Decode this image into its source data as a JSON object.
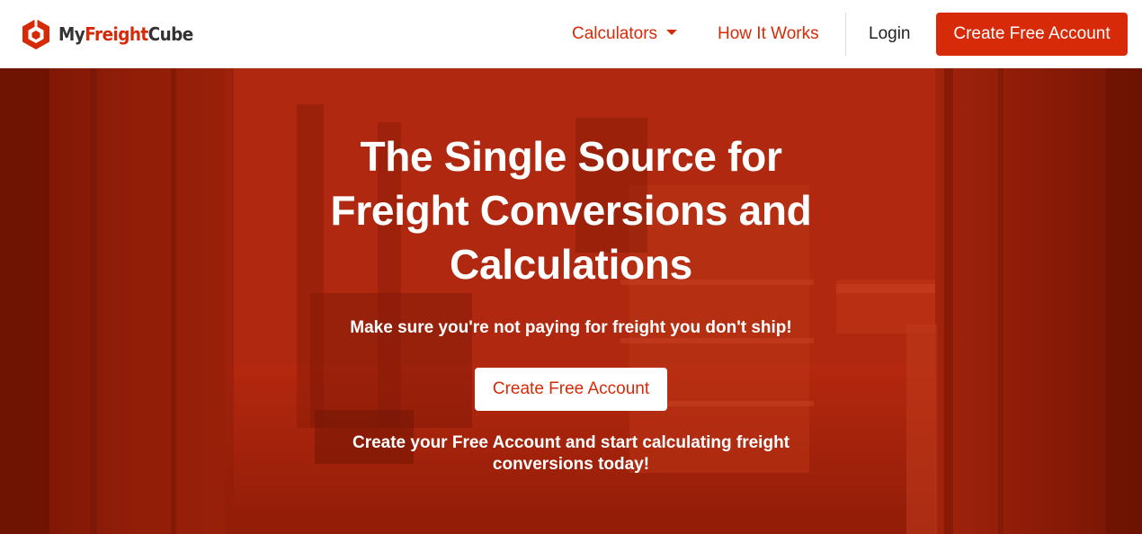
{
  "brand": {
    "name_part1": "My",
    "name_part2": "Freight",
    "name_part3": "Cube",
    "logo_icon": "cube-logo-icon"
  },
  "nav": {
    "calculators_label": "Calculators",
    "calculators_caret_icon": "caret-down-icon",
    "how_it_works_label": "How It Works",
    "login_label": "Login",
    "cta_label": "Create Free Account"
  },
  "hero": {
    "title": "The Single Source for Freight Conversions and Calculations",
    "subtitle": "Make sure you're not paying for freight you don't ship!",
    "cta_label": "Create Free Account",
    "note": "Create your Free Account and start calculating freight conversions today!"
  },
  "colors": {
    "accent": "#d62a08",
    "hero_overlay": "#a8230b",
    "text_dark": "#222222",
    "white": "#ffffff"
  }
}
